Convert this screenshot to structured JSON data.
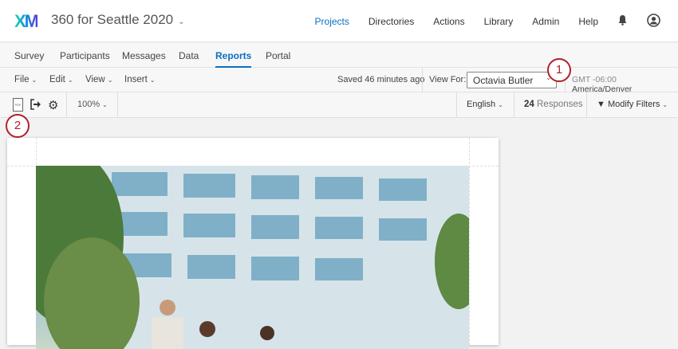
{
  "header": {
    "logo": "XM",
    "project_title": "360 for Seattle 2020",
    "nav": [
      "Projects",
      "Directories",
      "Actions",
      "Library",
      "Admin",
      "Help"
    ]
  },
  "tabs": [
    "Survey",
    "Participants",
    "Messages",
    "Data",
    "Reports",
    "Portal"
  ],
  "menu": {
    "items": [
      "File",
      "Edit",
      "View",
      "Insert"
    ],
    "saved_status": "Saved 46 minutes ago",
    "view_for_label": "View For:",
    "view_for_value": "Octavia Butler",
    "timezone_offset": "GMT -06:00",
    "timezone_name": "America/Denver"
  },
  "toolbar": {
    "pdf_icon_text": "PDF",
    "zoom": "100%",
    "language": "English",
    "responses_count": "24",
    "responses_label": "Responses",
    "modify_filters": "Modify Filters"
  },
  "callouts": [
    "1",
    "2"
  ]
}
